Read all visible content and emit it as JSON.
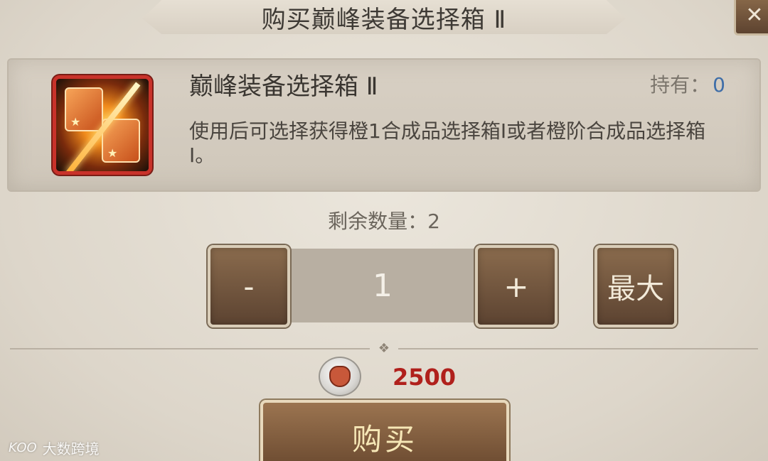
{
  "dialog": {
    "title": "购买巅峰装备选择箱 Ⅱ",
    "close_icon": "close-icon"
  },
  "item": {
    "name": "巅峰装备选择箱 Ⅱ",
    "owned_label": "持有：",
    "owned_count": "0",
    "description": "使用后可选择获得橙1合成品选择箱Ⅰ或者橙阶合成品选择箱Ⅰ。",
    "icon": "equipment-box-icon"
  },
  "quantity": {
    "remaining_label": "剩余数量：2",
    "value": "1",
    "minus_label": "-",
    "plus_label": "+",
    "max_label": "最大"
  },
  "cost": {
    "currency_icon": "coin-icon",
    "price": "2500"
  },
  "buy_label": "购买",
  "watermark": {
    "logo": "KOO",
    "text": "大数跨境"
  },
  "colors": {
    "price": "#b0201c",
    "owned_count": "#3f6ea8",
    "button_brown": "#6b4a30"
  }
}
